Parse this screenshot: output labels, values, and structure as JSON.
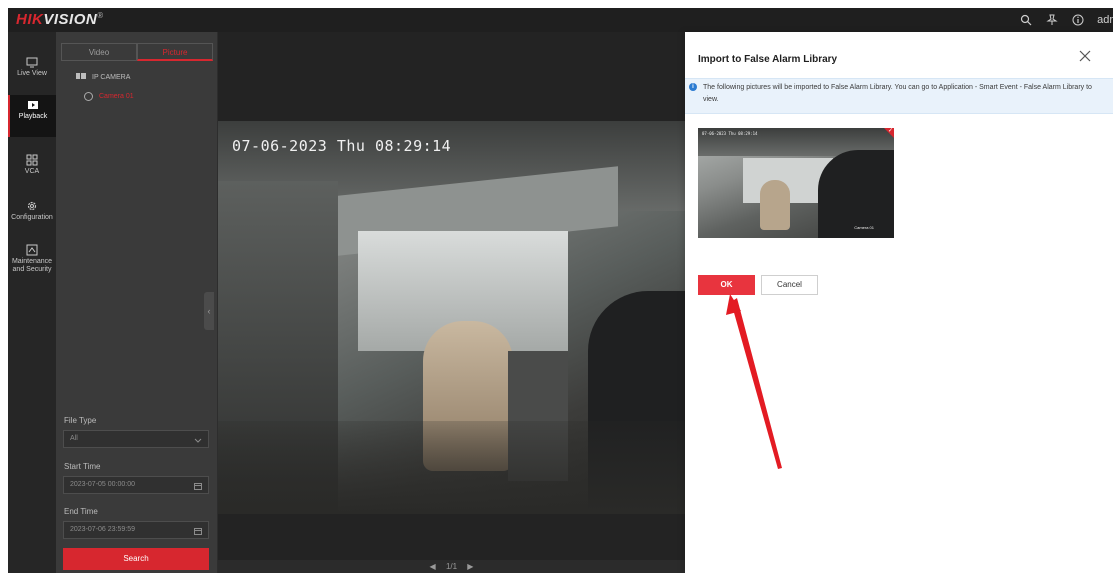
{
  "brand": {
    "name_red": "HIK",
    "name_white": "VISION",
    "reg": "®"
  },
  "topbar": {
    "user_text": "adr"
  },
  "nav": [
    {
      "label": "Live View",
      "icon": "monitor-icon"
    },
    {
      "label": "Playback",
      "icon": "playback-icon"
    },
    {
      "label": "VCA",
      "icon": "vca-icon"
    },
    {
      "label": "Configuration",
      "icon": "gear-icon"
    },
    {
      "label": "Maintenance and Security",
      "icon": "maintenance-icon"
    }
  ],
  "sidepanel": {
    "tabs": [
      "Video",
      "Picture"
    ],
    "active_tab": "Picture",
    "tree_root": "IP CAMERA",
    "tree_child": "Camera 01",
    "file_type_label": "File Type",
    "file_type_value": "All",
    "start_time_label": "Start Time",
    "start_time_value": "2023-07-05 00:00:00",
    "end_time_label": "End Time",
    "end_time_value": "2023-07-06 23:59:59",
    "search_label": "Search"
  },
  "video": {
    "osd_timestamp": "07-06-2023 Thu 08:29:14",
    "pager": "1/1"
  },
  "drawer": {
    "title": "Import to False Alarm Library",
    "info": "The following pictures will be imported to False Alarm Library. You can go to Application - Smart Event - False Alarm Library to view.",
    "thumb_osd": "07-06-2023 Thu 08:29:14",
    "thumb_label": "Camera 01",
    "ok_label": "OK",
    "cancel_label": "Cancel"
  },
  "colors": {
    "accent": "#d7272f",
    "info_bg": "#e9f2fb",
    "dark_bg": "#232323"
  }
}
